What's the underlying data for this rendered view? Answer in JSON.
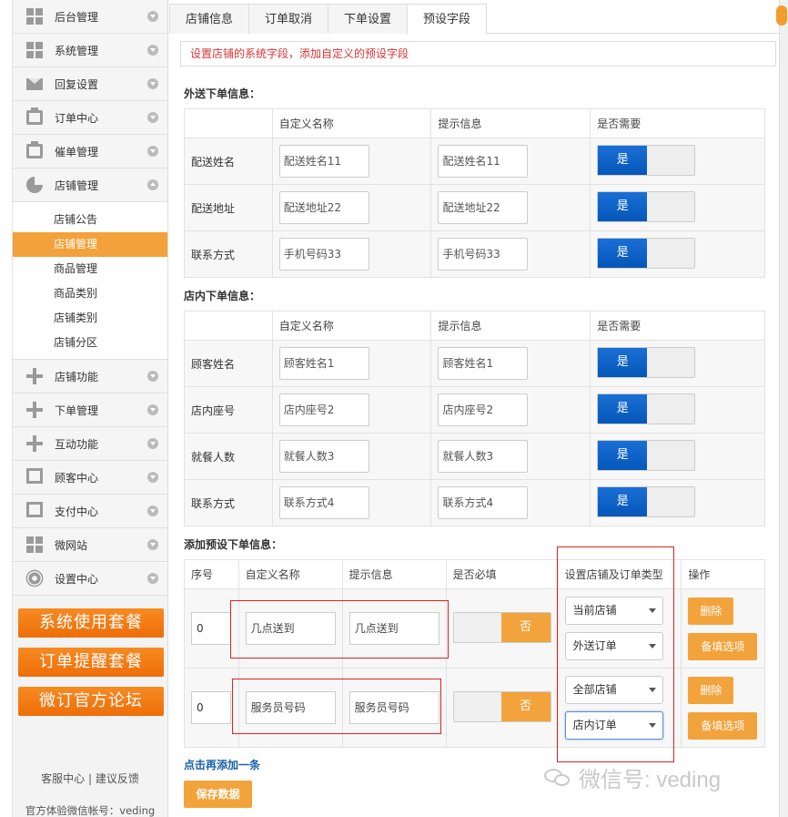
{
  "sidebar": {
    "items": [
      {
        "label": "后台管理",
        "icon": "grid-icon"
      },
      {
        "label": "系统管理",
        "icon": "grid-icon"
      },
      {
        "label": "回复设置",
        "icon": "mail-icon"
      },
      {
        "label": "订单中心",
        "icon": "printer-icon"
      },
      {
        "label": "催单管理",
        "icon": "printer-icon"
      },
      {
        "label": "店铺管理",
        "icon": "pie-icon"
      }
    ],
    "sub_items": [
      "店铺公告",
      "店铺管理",
      "商品管理",
      "商品类别",
      "店铺类别",
      "店铺分区"
    ],
    "items2": [
      {
        "label": "店铺功能",
        "icon": "plus-icon"
      },
      {
        "label": "下单管理",
        "icon": "plus-icon"
      },
      {
        "label": "互动功能",
        "icon": "plus-icon"
      },
      {
        "label": "顾客中心",
        "icon": "tray-icon"
      },
      {
        "label": "支付中心",
        "icon": "tray-icon"
      },
      {
        "label": "微网站",
        "icon": "grid-icon"
      },
      {
        "label": "设置中心",
        "icon": "gear-icon"
      }
    ],
    "promo": [
      "系统使用套餐",
      "订单提醒套餐",
      "微订官方论坛"
    ],
    "footer_links": "客服中心 | 建议反馈",
    "footer_account": "官方体验微信帐号：veding"
  },
  "tabs": [
    "店铺信息",
    "订单取消",
    "下单设置",
    "预设字段"
  ],
  "description": "设置店铺的系统字段，添加自定义的预设字段",
  "delivery": {
    "title": "外送下单信息：",
    "headers": [
      "",
      "自定义名称",
      "提示信息",
      "是否需要"
    ],
    "rows": [
      {
        "label": "配送姓名",
        "name": "配送姓名11",
        "hint": "配送姓名11",
        "toggle": "是"
      },
      {
        "label": "配送地址",
        "name": "配送地址22",
        "hint": "配送地址22",
        "toggle": "是"
      },
      {
        "label": "联系方式",
        "name": "手机号码33",
        "hint": "手机号码33",
        "toggle": "是"
      }
    ]
  },
  "dinein": {
    "title": "店内下单信息：",
    "headers": [
      "",
      "自定义名称",
      "提示信息",
      "是否需要"
    ],
    "rows": [
      {
        "label": "顾客姓名",
        "name": "顾客姓名1",
        "hint": "顾客姓名1",
        "toggle": "是"
      },
      {
        "label": "店内座号",
        "name": "店内座号2",
        "hint": "店内座号2",
        "toggle": "是"
      },
      {
        "label": "就餐人数",
        "name": "就餐人数3",
        "hint": "就餐人数3",
        "toggle": "是"
      },
      {
        "label": "联系方式",
        "name": "联系方式4",
        "hint": "联系方式4",
        "toggle": "是"
      }
    ]
  },
  "preset": {
    "title": "添加预设下单信息：",
    "headers": [
      "序号",
      "自定义名称",
      "提示信息",
      "是否必填",
      "设置店铺及订单类型",
      "操作"
    ],
    "rows": [
      {
        "seq": "0",
        "name": "几点送到",
        "hint": "几点送到",
        "toggle": "否",
        "shop": "当前店铺",
        "order": "外送订单",
        "delete": "删除",
        "options": "备填选项"
      },
      {
        "seq": "0",
        "name": "服务员号码",
        "hint": "服务员号码",
        "toggle": "否",
        "shop": "全部店铺",
        "order": "店内订单",
        "delete": "删除",
        "options": "备填选项"
      }
    ],
    "add_link": "点击再添加一条",
    "save_button": "保存数据"
  },
  "watermark": "微信号: veding"
}
